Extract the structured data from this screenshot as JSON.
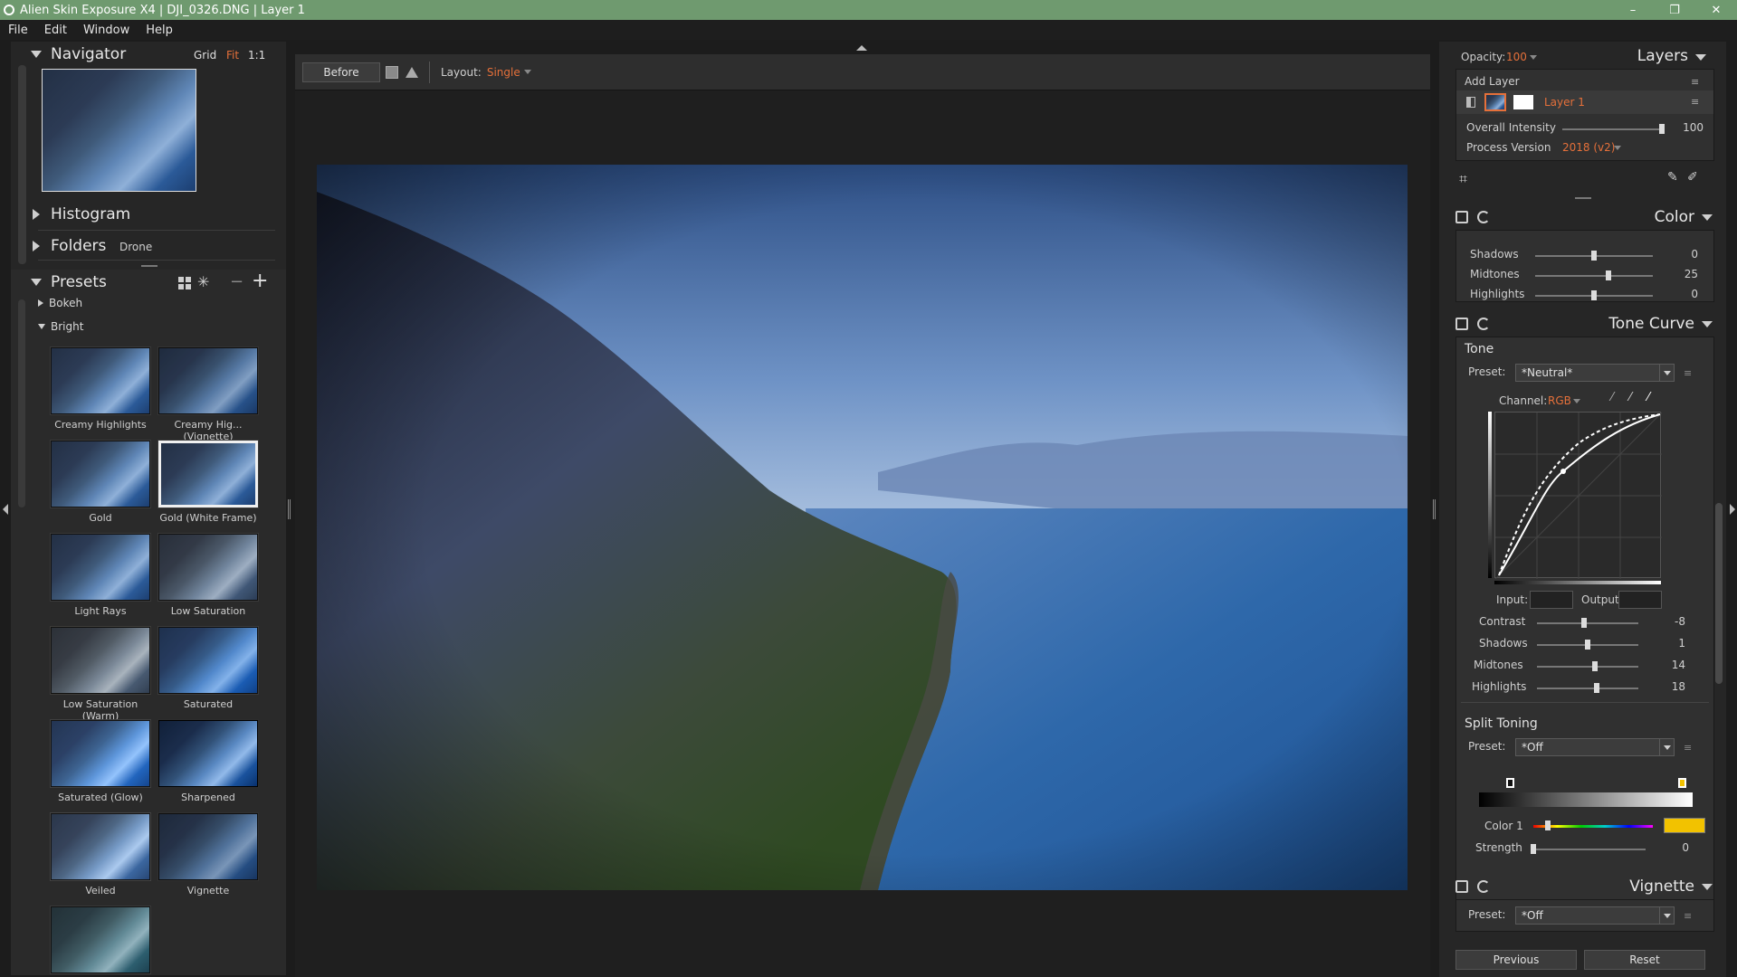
{
  "window": {
    "title": "Alien Skin Exposure X4 | DJI_0326.DNG | Layer 1",
    "controls": [
      "–",
      "❐",
      "✕"
    ]
  },
  "menu": [
    "File",
    "Edit",
    "Window",
    "Help"
  ],
  "navigator": {
    "title": "Navigator",
    "modes": {
      "grid": "Grid",
      "fit": "Fit",
      "one": "1:1"
    }
  },
  "histogram": {
    "title": "Histogram"
  },
  "folders": {
    "title": "Folders",
    "current": "Drone"
  },
  "presets": {
    "title": "Presets",
    "groups": [
      {
        "label": "Bokeh"
      },
      {
        "label": "Bright"
      }
    ],
    "items": [
      {
        "label": "Creamy Highlights"
      },
      {
        "label": "Creamy Hig...(Vignette)"
      },
      {
        "label": "Gold"
      },
      {
        "label": "Gold (White Frame)"
      },
      {
        "label": "Light Rays"
      },
      {
        "label": "Low Saturation"
      },
      {
        "label": "Low Saturation (Warm)"
      },
      {
        "label": "Saturated"
      },
      {
        "label": "Saturated (Glow)"
      },
      {
        "label": "Sharpened"
      },
      {
        "label": "Veiled"
      },
      {
        "label": "Vignette"
      },
      {
        "label": ""
      }
    ]
  },
  "toolbar": {
    "before": "Before",
    "layout_label": "Layout:",
    "layout_value": "Single"
  },
  "layers": {
    "title": "Layers",
    "opacity_label": "Opacity:",
    "opacity_value": "100",
    "add_layer": "Add Layer",
    "layer_name": "Layer 1",
    "overall_intensity_label": "Overall Intensity",
    "overall_intensity_value": "100",
    "overall_intensity_level": 1.0,
    "process_version_label": "Process Version",
    "process_version_value": "2018 (v2)"
  },
  "color": {
    "title": "Color",
    "sliders": [
      {
        "label": "Shadows",
        "value": "0",
        "level": 0.5
      },
      {
        "label": "Midtones",
        "value": "25",
        "level": 0.62
      },
      {
        "label": "Highlights",
        "value": "0",
        "level": 0.5
      }
    ]
  },
  "tone_curve": {
    "title": "Tone Curve",
    "tone_label": "Tone",
    "preset_label": "Preset:",
    "preset_value": "*Neutral*",
    "channel_label": "Channel:",
    "channel_value": "RGB",
    "input_label": "Input:",
    "output_label": "Output:",
    "sliders": [
      {
        "label": "Contrast",
        "value": "-8",
        "level": 0.46
      },
      {
        "label": "Shadows",
        "value": "1",
        "level": 0.5
      },
      {
        "label": "Midtones",
        "value": "14",
        "level": 0.57
      },
      {
        "label": "Highlights",
        "value": "18",
        "level": 0.59
      }
    ]
  },
  "split_toning": {
    "title": "Split Toning",
    "preset_label": "Preset:",
    "preset_value": "*Off",
    "color1_label": "Color 1",
    "color1_hue_level": 0.12,
    "color1_swatch": "#f2c200",
    "strength_label": "Strength",
    "strength_value": "0",
    "strength_level": 0.0
  },
  "vignette": {
    "title": "Vignette",
    "preset_label": "Preset:",
    "preset_value": "*Off"
  },
  "footer": {
    "previous": "Previous",
    "reset": "Reset"
  },
  "colors": {
    "accent": "#e5703a",
    "titlebar": "#6f9a6f"
  }
}
